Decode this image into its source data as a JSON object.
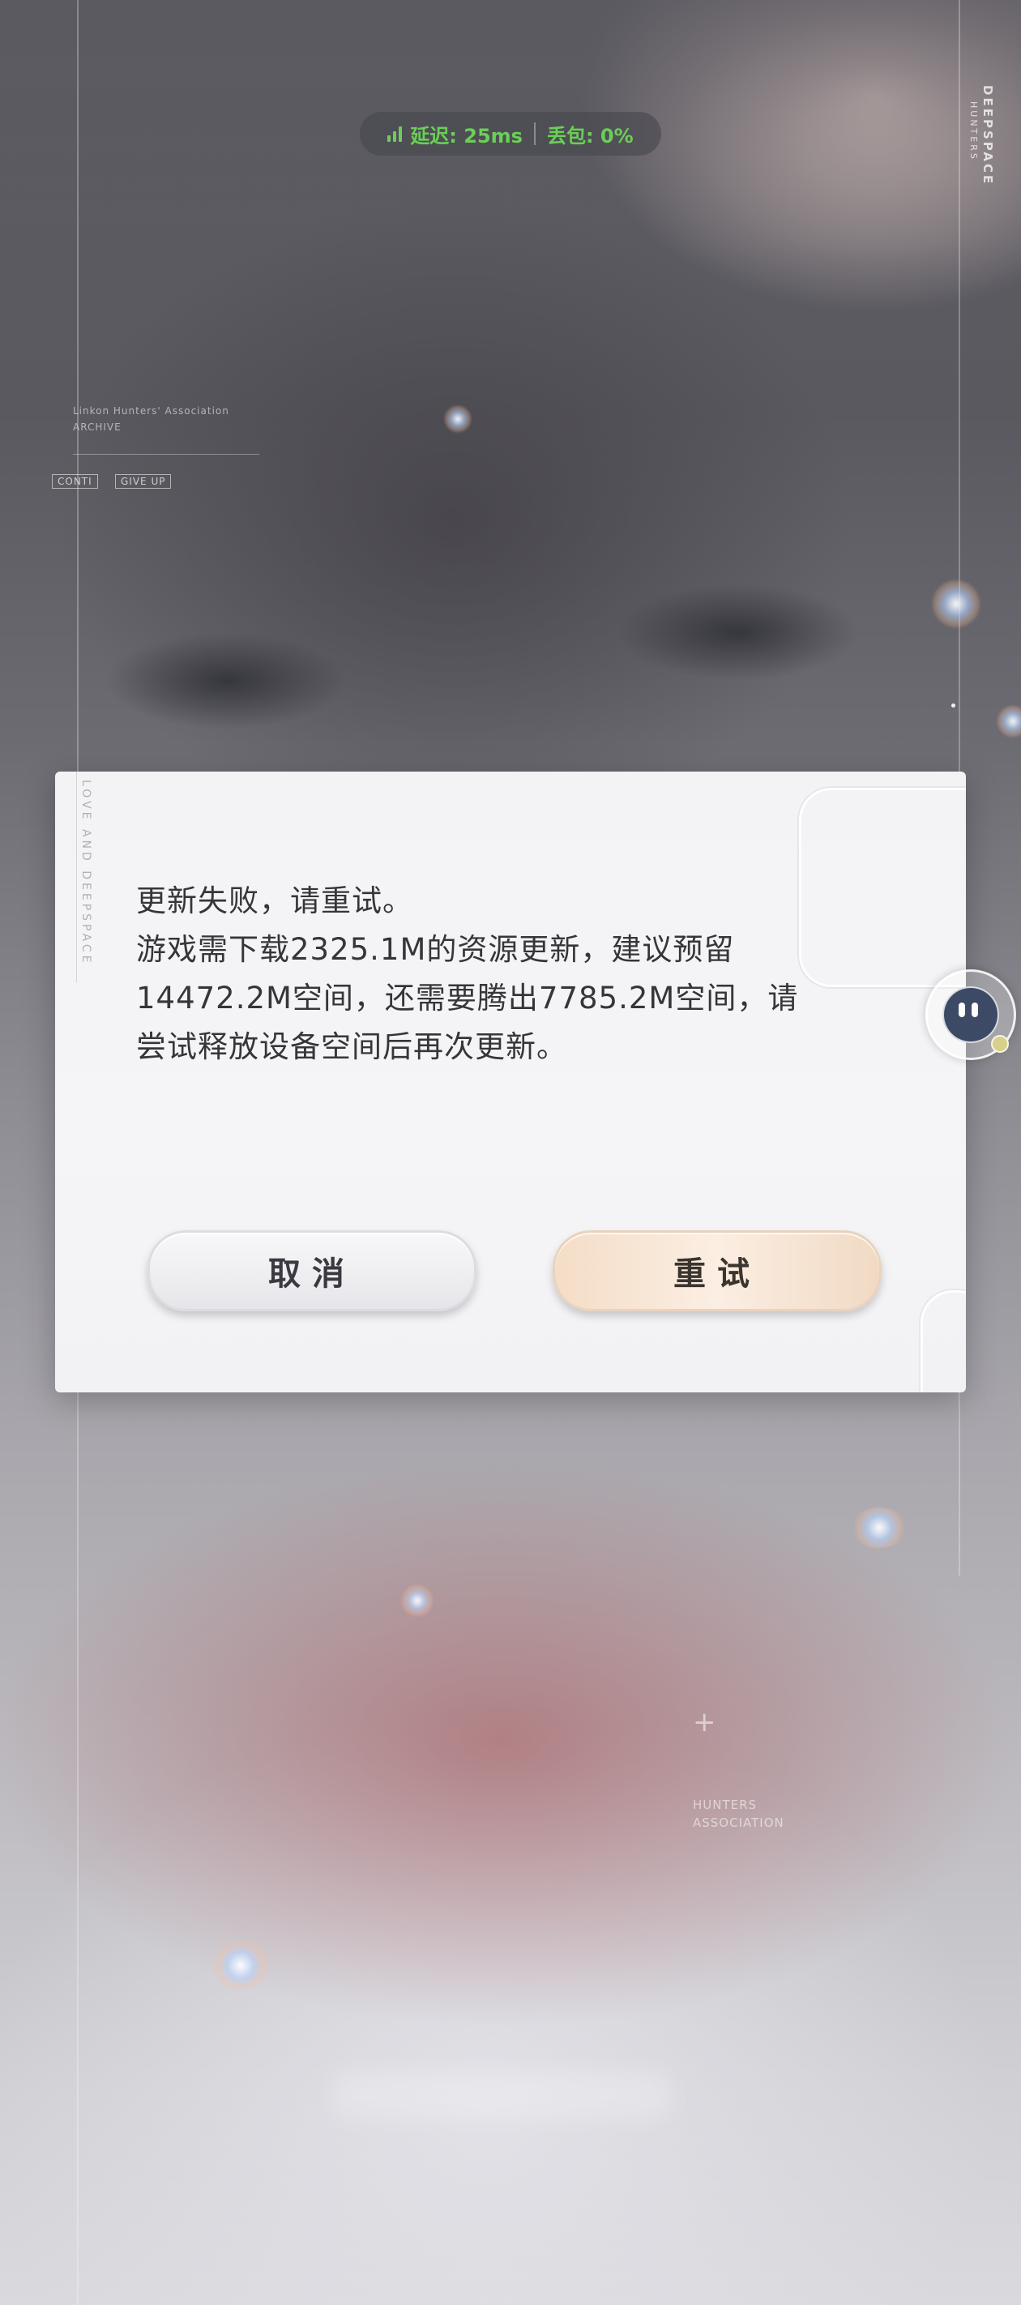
{
  "network": {
    "latency": "延迟: 25ms",
    "packet_loss": "丢包: 0%",
    "status_color": "#6bcf57"
  },
  "background": {
    "brand_vertical": "DEEPSPACE",
    "brand_sub": "HUNTERS",
    "box_left": "CONTI",
    "box_right": "GIVE UP",
    "corner_note_1": "Linkon Hunters' Association",
    "corner_note_2": "ARCHIVE",
    "hunters_line_1": "HUNTERS",
    "hunters_line_2": "ASSOCIATION"
  },
  "dialog": {
    "side_text": "LOVE AND DEEPSPACE",
    "lines": [
      "更新失败，请重试。",
      "游戏需下载2325.1M的资源更新，建议预留",
      "14472.2M空间，还需要腾出7785.2M空间，请",
      "尝试释放设备空间后再次更新。"
    ],
    "cancel_label": "取消",
    "retry_label": "重试"
  },
  "colors": {
    "dialog_bg": "#f4f4f6",
    "text": "#36353a",
    "retry_accent": "#f4ddc7"
  },
  "icons": {
    "signal": "signal-bars-icon",
    "assistant": "assistant-float-icon"
  }
}
